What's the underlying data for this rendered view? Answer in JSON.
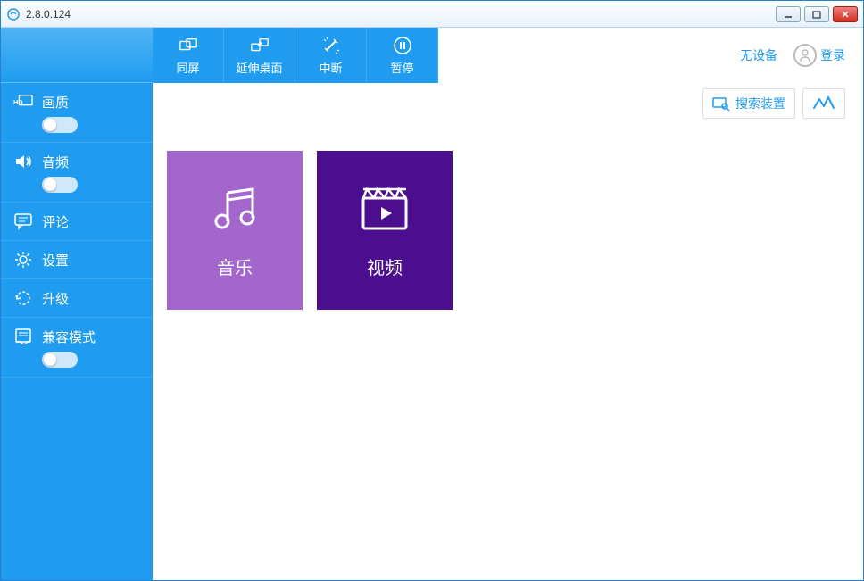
{
  "window": {
    "title": "2.8.0.124"
  },
  "sidebar": {
    "items": [
      {
        "label": "画质",
        "icon": "hd-icon",
        "has_toggle": true
      },
      {
        "label": "音频",
        "icon": "speaker-icon",
        "has_toggle": true
      },
      {
        "label": "评论",
        "icon": "comment-icon",
        "has_toggle": false
      },
      {
        "label": "设置",
        "icon": "gear-icon",
        "has_toggle": false
      },
      {
        "label": "升级",
        "icon": "refresh-icon",
        "has_toggle": false
      },
      {
        "label": "兼容模式",
        "icon": "compat-icon",
        "has_toggle": true
      }
    ]
  },
  "toolbar": {
    "buttons": [
      {
        "label": "同屏",
        "icon": "mirror-icon"
      },
      {
        "label": "延伸桌面",
        "icon": "extend-icon"
      },
      {
        "label": "中断",
        "icon": "disconnect-icon"
      },
      {
        "label": "暂停",
        "icon": "pause-icon"
      }
    ],
    "no_device": "无设备",
    "login": "登录",
    "search": "搜索装置"
  },
  "tiles": [
    {
      "label": "音乐",
      "class": "music",
      "icon": "music-icon"
    },
    {
      "label": "视频",
      "class": "video",
      "icon": "video-icon"
    }
  ]
}
